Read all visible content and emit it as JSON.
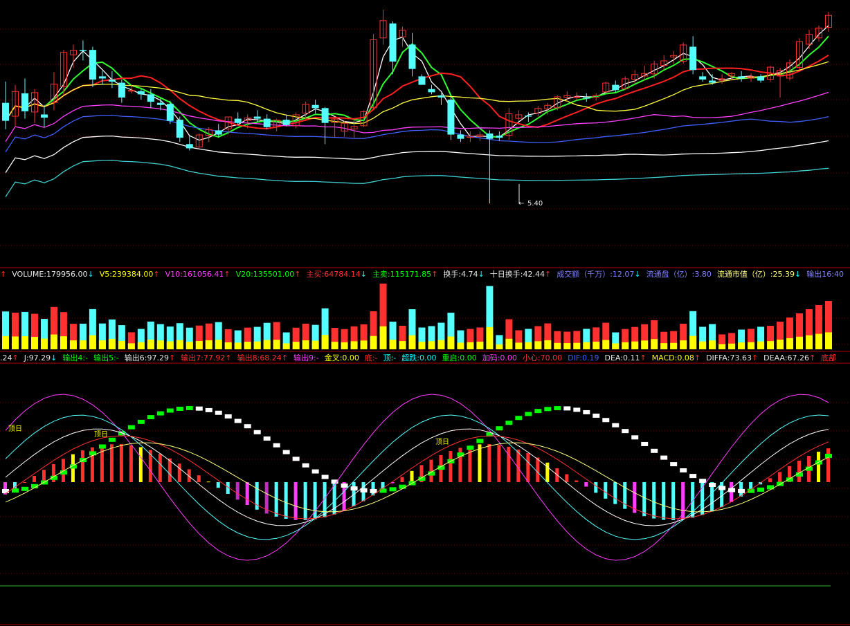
{
  "colors": {
    "background": "#000000",
    "up": "#ff3030",
    "down": "#54ffff",
    "grid": "#7a0000",
    "separator": "#b00000"
  },
  "volume_header": [
    {
      "text": "",
      "color": "#ff3030",
      "arrow": "up"
    },
    {
      "text": "VOLUME:179956.00",
      "color": "#e6e6e6",
      "arrow": "down"
    },
    {
      "text": "V5:239384.00",
      "color": "#ffff00",
      "arrow": "up"
    },
    {
      "text": "V10:161056.41",
      "color": "#ff3cff",
      "arrow": "up"
    },
    {
      "text": "V20:135501.00",
      "color": "#00ff00",
      "arrow": "up"
    },
    {
      "text": "主买:64784.14",
      "color": "#ff3030",
      "arrow": "down"
    },
    {
      "text": "主卖:115171.85",
      "color": "#00ff00",
      "arrow": "up"
    },
    {
      "text": "换手:4.74",
      "color": "#e6e6e6",
      "arrow": "down"
    },
    {
      "text": "十日换手:42.44",
      "color": "#e6e6e6",
      "arrow": "up"
    },
    {
      "text": "成交额（千万）:12.07",
      "color": "#8080ff",
      "arrow": "down"
    },
    {
      "text": "流通盘（亿）:3.80",
      "color": "#8080ff",
      "arrow": ""
    },
    {
      "text": "流通市值（亿）:25.39",
      "color": "#ffff80",
      "arrow": "down"
    },
    {
      "text": "输出16:40",
      "color": "#8080ff",
      "arrow": ""
    }
  ],
  "indicator_header": [
    {
      "text": ".24",
      "color": "#e6e6e6",
      "arrow": "up"
    },
    {
      "text": "J:97.29",
      "color": "#e6e6e6",
      "arrow": "down"
    },
    {
      "text": "输出4:-",
      "color": "#00ff00",
      "arrow": ""
    },
    {
      "text": "输出5:-",
      "color": "#00ff00",
      "arrow": ""
    },
    {
      "text": "输出6:97.29",
      "color": "#e6e6e6",
      "arrow": "up"
    },
    {
      "text": "输出7:77.92",
      "color": "#ff3030",
      "arrow": "up"
    },
    {
      "text": "输出8:68.24",
      "color": "#ff3030",
      "arrow": "up"
    },
    {
      "text": "输出9:-",
      "color": "#ff3cff",
      "arrow": ""
    },
    {
      "text": "金叉:0.00",
      "color": "#ffff00",
      "arrow": ""
    },
    {
      "text": "底:-",
      "color": "#ff3030",
      "arrow": ""
    },
    {
      "text": "顶:-",
      "color": "#00ffff",
      "arrow": ""
    },
    {
      "text": "超跌:0.00",
      "color": "#00ffff",
      "arrow": ""
    },
    {
      "text": "重启:0.00",
      "color": "#00ff00",
      "arrow": ""
    },
    {
      "text": "加码:0.00",
      "color": "#ff3cff",
      "arrow": ""
    },
    {
      "text": "小心:70.00",
      "color": "#ff3030",
      "arrow": ""
    },
    {
      "text": "DIF:0.19",
      "color": "#4060ff",
      "arrow": ""
    },
    {
      "text": "DEA:0.11",
      "color": "#e6e6e6",
      "arrow": "up"
    },
    {
      "text": "MACD:0.08",
      "color": "#ffff00",
      "arrow": "up"
    },
    {
      "text": "DIFFA:73.63",
      "color": "#e6e6e6",
      "arrow": "up"
    },
    {
      "text": "DEAA:67.26",
      "color": "#e6e6e6",
      "arrow": "up"
    },
    {
      "text": "底部",
      "color": "#ff3030",
      "arrow": ""
    }
  ],
  "chart_data": [
    {
      "type": "candlestick",
      "low_label": "5.40",
      "marker_labels": [
        "顶日"
      ],
      "candles": [
        {
          "o": 6.35,
          "h": 6.55,
          "l": 6.1,
          "c": 6.18
        },
        {
          "o": 6.22,
          "h": 6.52,
          "l": 6.12,
          "c": 6.46
        },
        {
          "o": 6.44,
          "h": 6.58,
          "l": 6.2,
          "c": 6.27
        },
        {
          "o": 6.26,
          "h": 6.48,
          "l": 6.16,
          "c": 6.45
        },
        {
          "o": 6.24,
          "h": 6.33,
          "l": 6.12,
          "c": 6.21
        },
        {
          "o": 6.35,
          "h": 6.64,
          "l": 6.28,
          "c": 6.53
        },
        {
          "o": 6.5,
          "h": 6.85,
          "l": 6.42,
          "c": 6.83
        },
        {
          "o": 6.8,
          "h": 6.9,
          "l": 6.68,
          "c": 6.85
        },
        {
          "o": 6.85,
          "h": 6.94,
          "l": 6.75,
          "c": 6.84
        },
        {
          "o": 6.85,
          "h": 6.88,
          "l": 6.5,
          "c": 6.57
        },
        {
          "o": 6.6,
          "h": 6.65,
          "l": 6.52,
          "c": 6.58
        },
        {
          "o": 6.57,
          "h": 6.65,
          "l": 6.49,
          "c": 6.55
        },
        {
          "o": 6.54,
          "h": 6.57,
          "l": 6.35,
          "c": 6.4
        },
        {
          "o": 6.47,
          "h": 6.52,
          "l": 6.44,
          "c": 6.47
        },
        {
          "o": 6.46,
          "h": 6.48,
          "l": 6.38,
          "c": 6.43
        },
        {
          "o": 6.43,
          "h": 6.48,
          "l": 6.3,
          "c": 6.36
        },
        {
          "o": 6.35,
          "h": 6.39,
          "l": 6.28,
          "c": 6.33
        },
        {
          "o": 6.34,
          "h": 6.37,
          "l": 6.15,
          "c": 6.18
        },
        {
          "o": 6.19,
          "h": 6.22,
          "l": 5.98,
          "c": 6.02
        },
        {
          "o": 5.96,
          "h": 6.04,
          "l": 5.9,
          "c": 5.92
        },
        {
          "o": 5.93,
          "h": 6.06,
          "l": 5.92,
          "c": 6.05
        },
        {
          "o": 6.04,
          "h": 6.12,
          "l": 5.98,
          "c": 6.1
        },
        {
          "o": 6.09,
          "h": 6.15,
          "l": 6.02,
          "c": 6.05
        },
        {
          "o": 6.1,
          "h": 6.22,
          "l": 6.05,
          "c": 6.22
        },
        {
          "o": 6.2,
          "h": 6.26,
          "l": 6.14,
          "c": 6.16
        },
        {
          "o": 6.18,
          "h": 6.24,
          "l": 6.11,
          "c": 6.21
        },
        {
          "o": 6.22,
          "h": 6.28,
          "l": 6.17,
          "c": 6.2
        },
        {
          "o": 6.2,
          "h": 6.24,
          "l": 6.1,
          "c": 6.12
        },
        {
          "o": 6.12,
          "h": 6.2,
          "l": 6.08,
          "c": 6.19
        },
        {
          "o": 6.19,
          "h": 6.24,
          "l": 6.13,
          "c": 6.14
        },
        {
          "o": 6.13,
          "h": 6.26,
          "l": 6.11,
          "c": 6.24
        },
        {
          "o": 6.25,
          "h": 6.36,
          "l": 6.18,
          "c": 6.34
        },
        {
          "o": 6.33,
          "h": 6.38,
          "l": 6.25,
          "c": 6.3
        },
        {
          "o": 6.3,
          "h": 6.31,
          "l": 5.96,
          "c": 6.16
        },
        {
          "o": 6.16,
          "h": 6.22,
          "l": 6.02,
          "c": 6.2
        },
        {
          "o": 6.08,
          "h": 6.18,
          "l": 6.03,
          "c": 6.16
        },
        {
          "o": 6.1,
          "h": 6.18,
          "l": 6.02,
          "c": 6.13
        },
        {
          "o": 6.13,
          "h": 6.28,
          "l": 6.12,
          "c": 6.27
        },
        {
          "o": 6.3,
          "h": 7.0,
          "l": 6.28,
          "c": 6.95
        },
        {
          "o": 6.96,
          "h": 7.23,
          "l": 6.9,
          "c": 7.13
        },
        {
          "o": 7.1,
          "h": 7.12,
          "l": 6.62,
          "c": 6.74
        },
        {
          "o": 6.97,
          "h": 7.07,
          "l": 6.88,
          "c": 7.04
        },
        {
          "o": 6.9,
          "h": 7.01,
          "l": 6.6,
          "c": 6.67
        },
        {
          "o": 6.6,
          "h": 6.62,
          "l": 6.52,
          "c": 6.52
        },
        {
          "o": 6.48,
          "h": 6.52,
          "l": 6.43,
          "c": 6.45
        },
        {
          "o": 6.42,
          "h": 6.44,
          "l": 6.33,
          "c": 6.4
        },
        {
          "o": 6.38,
          "h": 6.41,
          "l": 6.0,
          "c": 6.05
        },
        {
          "o": 6.05,
          "h": 6.09,
          "l": 5.98,
          "c": 6.01
        },
        {
          "o": 6.02,
          "h": 6.08,
          "l": 5.98,
          "c": 6.04
        },
        {
          "o": 6.03,
          "h": 6.08,
          "l": 5.99,
          "c": 6.05
        },
        {
          "o": 6.06,
          "h": 6.09,
          "l": 5.4,
          "c": 6.01
        },
        {
          "o": 6.04,
          "h": 6.08,
          "l": 5.99,
          "c": 6.02
        },
        {
          "o": 6.04,
          "h": 6.3,
          "l": 6.0,
          "c": 6.25
        },
        {
          "o": 6.2,
          "h": 6.28,
          "l": 6.18,
          "c": 6.24
        },
        {
          "o": 6.23,
          "h": 6.26,
          "l": 6.17,
          "c": 6.22
        },
        {
          "o": 6.25,
          "h": 6.32,
          "l": 6.22,
          "c": 6.3
        },
        {
          "o": 6.29,
          "h": 6.35,
          "l": 6.24,
          "c": 6.33
        },
        {
          "o": 6.3,
          "h": 6.42,
          "l": 6.28,
          "c": 6.41
        },
        {
          "o": 6.4,
          "h": 6.46,
          "l": 6.36,
          "c": 6.42
        },
        {
          "o": 6.41,
          "h": 6.45,
          "l": 6.37,
          "c": 6.41
        },
        {
          "o": 6.4,
          "h": 6.44,
          "l": 6.36,
          "c": 6.39
        },
        {
          "o": 6.4,
          "h": 6.44,
          "l": 6.37,
          "c": 6.42
        },
        {
          "o": 6.45,
          "h": 6.55,
          "l": 6.44,
          "c": 6.54
        },
        {
          "o": 6.52,
          "h": 6.56,
          "l": 6.45,
          "c": 6.47
        },
        {
          "o": 6.48,
          "h": 6.6,
          "l": 6.47,
          "c": 6.58
        },
        {
          "o": 6.57,
          "h": 6.66,
          "l": 6.53,
          "c": 6.62
        },
        {
          "o": 6.6,
          "h": 6.7,
          "l": 6.56,
          "c": 6.63
        },
        {
          "o": 6.62,
          "h": 6.75,
          "l": 6.58,
          "c": 6.72
        },
        {
          "o": 6.7,
          "h": 6.8,
          "l": 6.66,
          "c": 6.75
        },
        {
          "o": 6.78,
          "h": 6.84,
          "l": 6.72,
          "c": 6.8
        },
        {
          "o": 6.74,
          "h": 6.92,
          "l": 6.72,
          "c": 6.9
        },
        {
          "o": 6.88,
          "h": 6.98,
          "l": 6.62,
          "c": 6.66
        },
        {
          "o": 6.6,
          "h": 6.64,
          "l": 6.55,
          "c": 6.57
        },
        {
          "o": 6.56,
          "h": 6.62,
          "l": 6.52,
          "c": 6.54
        },
        {
          "o": 6.56,
          "h": 6.62,
          "l": 6.53,
          "c": 6.58
        },
        {
          "o": 6.6,
          "h": 6.64,
          "l": 6.56,
          "c": 6.63
        },
        {
          "o": 6.6,
          "h": 6.65,
          "l": 6.55,
          "c": 6.58
        },
        {
          "o": 6.58,
          "h": 6.63,
          "l": 6.55,
          "c": 6.6
        },
        {
          "o": 6.6,
          "h": 6.62,
          "l": 6.54,
          "c": 6.56
        },
        {
          "o": 6.57,
          "h": 6.7,
          "l": 6.55,
          "c": 6.69
        },
        {
          "o": 6.6,
          "h": 6.68,
          "l": 6.4,
          "c": 6.66
        },
        {
          "o": 6.58,
          "h": 6.76,
          "l": 6.56,
          "c": 6.73
        },
        {
          "o": 6.68,
          "h": 6.96,
          "l": 6.66,
          "c": 6.93
        },
        {
          "o": 6.9,
          "h": 7.04,
          "l": 6.86,
          "c": 7.0
        },
        {
          "o": 6.96,
          "h": 7.08,
          "l": 6.93,
          "c": 7.06
        },
        {
          "o": 7.06,
          "h": 7.21,
          "l": 7.02,
          "c": 7.18
        }
      ]
    }
  ]
}
